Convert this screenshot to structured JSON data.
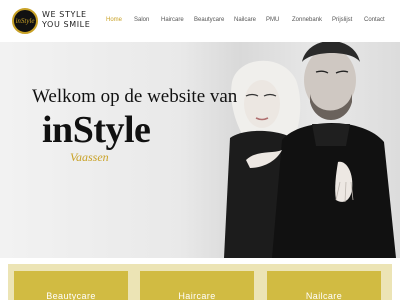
{
  "header": {
    "logo_icon": "instyle-logo-icon",
    "slogan_line1": "WE STYLE",
    "slogan_line2": "YOU SMILE",
    "nav": [
      {
        "label": "Home",
        "active": true
      },
      {
        "label": "Salon"
      },
      {
        "label": "Haircare"
      },
      {
        "label": "Beautycare"
      },
      {
        "label": "Nailcare"
      },
      {
        "label": "PMU"
      },
      {
        "label": "Zonnebank"
      },
      {
        "label": "Prijslijst"
      },
      {
        "label": "Contact"
      }
    ]
  },
  "hero": {
    "welcome": "Welkom op de website van",
    "brand": "inStyle",
    "location": "Vaassen"
  },
  "services": [
    {
      "title": "Beautycare"
    },
    {
      "title": "Haircare"
    },
    {
      "title": "Nailcare"
    }
  ],
  "colors": {
    "accent": "#c9a227",
    "card": "#d1bb42",
    "strip": "#ece4b5"
  }
}
